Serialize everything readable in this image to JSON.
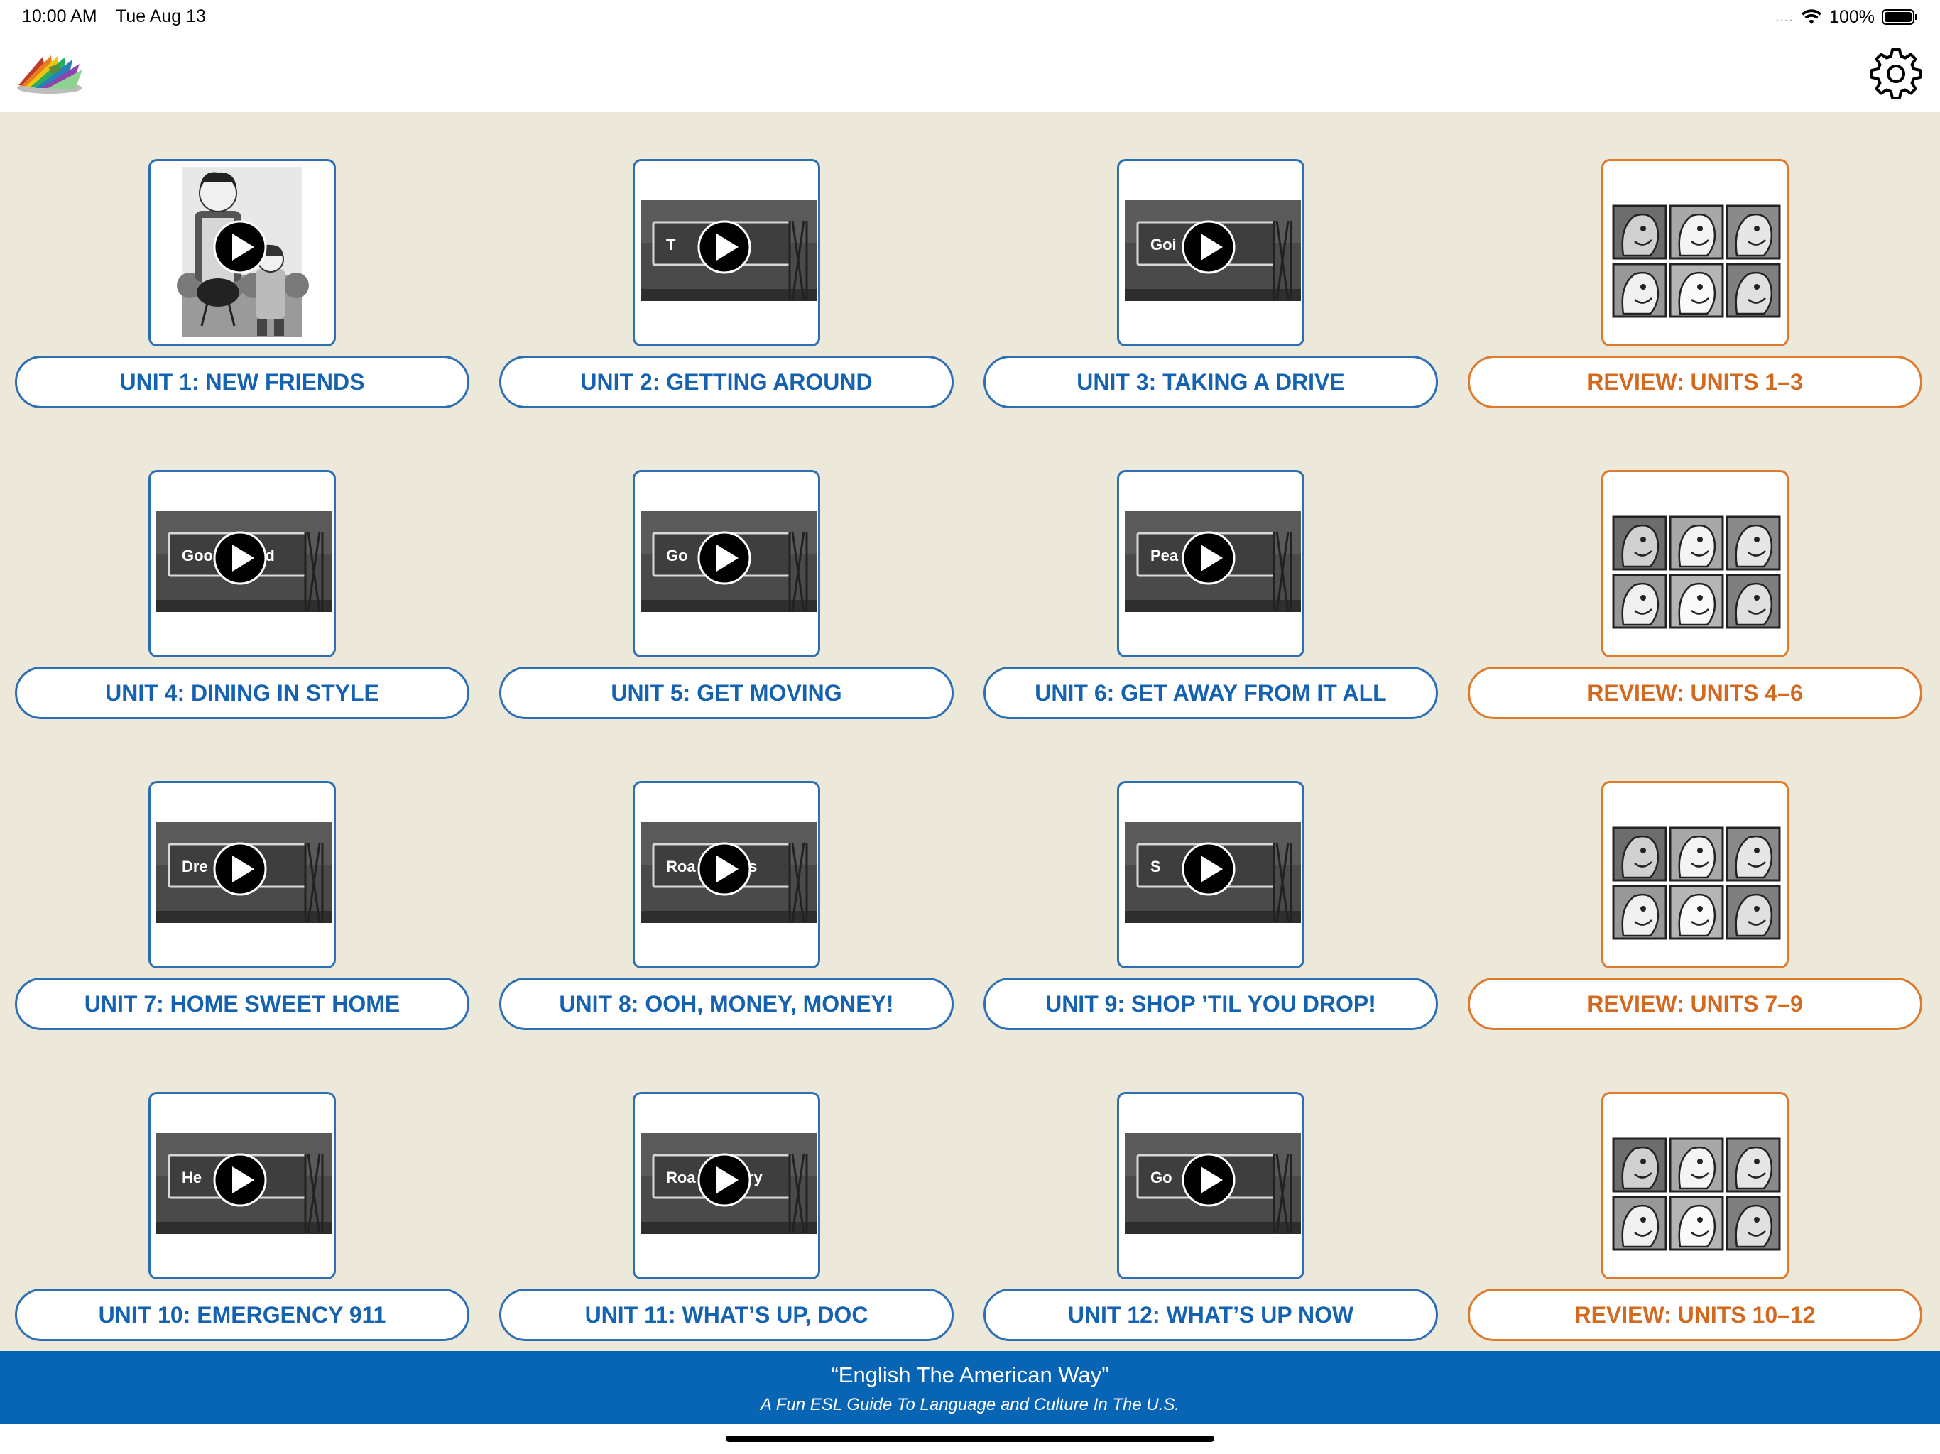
{
  "status_bar": {
    "time": "10:00 AM",
    "date": "Tue Aug 13",
    "signal": "....",
    "battery": "100%",
    "battery_level": 1.0
  },
  "nav": {
    "logo_icon": "color-swatch-fan-logo",
    "settings_icon": "gear-icon"
  },
  "units": [
    {
      "label": "UNIT 1: NEW FRIENDS",
      "type": "unit",
      "thumb": "cartoon",
      "sign_text": ""
    },
    {
      "label": "UNIT 2: GETTING AROUND",
      "type": "unit",
      "thumb": "billboard",
      "sign_text": "T       y"
    },
    {
      "label": "UNIT 3: TAKING A DRIVE",
      "type": "unit",
      "thumb": "billboard",
      "sign_text": "Goi       es"
    },
    {
      "label": "REVIEW: UNITS 1–3",
      "type": "review",
      "thumb": "faces",
      "sign_text": ""
    },
    {
      "label": "UNIT 4: DINING IN STYLE",
      "type": "unit",
      "thumb": "billboard",
      "sign_text": "Goo        ead"
    },
    {
      "label": "UNIT 5: GET MOVING",
      "type": "unit",
      "thumb": "billboard",
      "sign_text": "Go        es"
    },
    {
      "label": "UNIT 6: GET AWAY FROM IT ALL",
      "type": "unit",
      "thumb": "billboard",
      "sign_text": "Pea        iet"
    },
    {
      "label": "REVIEW: UNITS 4–6",
      "type": "review",
      "thumb": "faces",
      "sign_text": ""
    },
    {
      "label": "UNIT 7: HOME SWEET HOME",
      "type": "unit",
      "thumb": "billboard",
      "sign_text": "Dre        ne"
    },
    {
      "label": "UNIT 8: OOH, MONEY, MONEY!",
      "type": "unit",
      "thumb": "billboard",
      "sign_text": "Roa        hes"
    },
    {
      "label": "UNIT 9: SHOP ’TIL YOU DROP!",
      "type": "unit",
      "thumb": "billboard",
      "sign_text": "S        g"
    },
    {
      "label": "REVIEW: UNITS 7–9",
      "type": "review",
      "thumb": "faces",
      "sign_text": ""
    },
    {
      "label": "UNIT 10: EMERGENCY 911",
      "type": "unit",
      "thumb": "billboard",
      "sign_text": "He        ad"
    },
    {
      "label": "UNIT 11: WHAT’S UP, DOC",
      "type": "unit",
      "thumb": "billboard",
      "sign_text": "Roa        very"
    },
    {
      "label": "UNIT 12: WHAT’S UP NOW",
      "type": "unit",
      "thumb": "billboard",
      "sign_text": "Go        lth"
    },
    {
      "label": "REVIEW: UNITS 10–12",
      "type": "review",
      "thumb": "faces",
      "sign_text": ""
    }
  ],
  "footer": {
    "title": "“English The American Way”",
    "subtitle": "A Fun ESL Guide To Language and Culture In The U.S."
  },
  "colors": {
    "unit_accent": "#2d6fb5",
    "unit_text": "#1562b0",
    "review_accent": "#de7a2c",
    "review_text": "#d2691e",
    "content_bg": "#ede9da",
    "footer_bg": "#0864b4"
  }
}
